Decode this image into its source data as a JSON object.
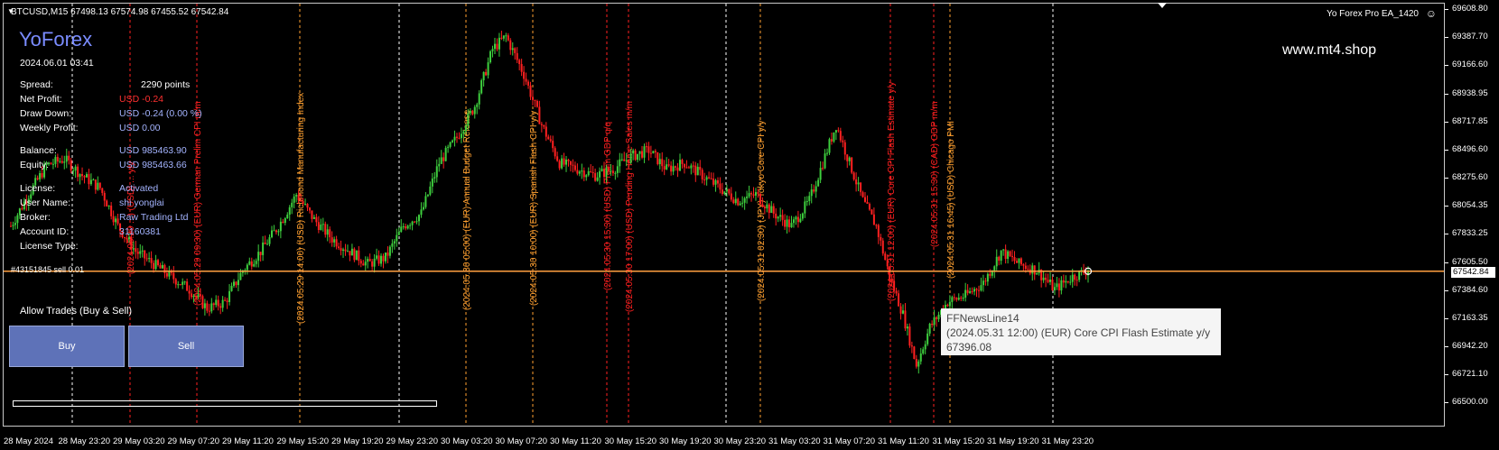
{
  "header": {
    "symbol_info": "BTCUSD,M15  67498.13 67574.98 67455.52 67542.84",
    "ea_name": "Yo Forex Pro EA_1420"
  },
  "panel": {
    "brand": "YoForex",
    "datetime": "2024.06.01 03:41",
    "website": "www.mt4.shop",
    "rows": [
      {
        "label": "Spread:",
        "value": "2290 points"
      },
      {
        "label": "Net Profit:",
        "value": "USD -0.24"
      },
      {
        "label": "Draw Down:",
        "value": "USD -0.24 (0.00 %)"
      },
      {
        "label": "Weekly Profit:",
        "value": "USD 0.00"
      },
      {
        "label": "Balance:",
        "value": "USD 985463.90"
      },
      {
        "label": "Equity:",
        "value": "USD 985463.66"
      },
      {
        "label": "License:",
        "value": "Activated"
      },
      {
        "label": "User Name:",
        "value": "shi yonglai"
      },
      {
        "label": "Broker:",
        "value": "Raw Trading Ltd"
      },
      {
        "label": "Account ID:",
        "value": "31160381"
      },
      {
        "label": "License Type:",
        "value": ""
      }
    ],
    "order_label": "#43151845 sell 0.01",
    "allow_trades": "Allow Trades (Buy & Sell)",
    "buy_label": "Buy",
    "sell_label": "Sell"
  },
  "tooltip": {
    "title": "FFNewsLine14",
    "event": "(2024.05.31 12:00) (EUR) Core CPI Flash Estimate y/y",
    "price": "67396.08"
  },
  "price_axis": {
    "ticks": [
      "69608.80",
      "69387.70",
      "69166.60",
      "68938.95",
      "68717.85",
      "68496.60",
      "68275.60",
      "68054.35",
      "67833.25",
      "67605.50",
      "67384.60",
      "67163.35",
      "66942.20",
      "66721.10",
      "66500.00"
    ],
    "current_price": "67542.84"
  },
  "time_axis": {
    "ticks": [
      "28 May 2024",
      "28 May 23:20",
      "29 May 03:20",
      "29 May 07:20",
      "29 May 11:20",
      "29 May 15:20",
      "29 May 19:20",
      "29 May 23:20",
      "30 May 03:20",
      "30 May 07:20",
      "30 May 11:20",
      "30 May 15:20",
      "30 May 19:20",
      "30 May 23:20",
      "31 May 03:20",
      "31 May 07:20",
      "31 May 11:20",
      "31 May 15:20",
      "31 May 19:20",
      "31 May 23:20"
    ]
  },
  "news_lines": [
    {
      "text": "(2024.05.29 ...) (USD) ... y/y",
      "color": "#ff2020"
    },
    {
      "text": "(2024.05.29 09:30) (EUR) German Prelim CPI m/m",
      "color": "#ff2020"
    },
    {
      "text": "(2024.05.29 14:00) (USD) Richmond Manufacturing Index",
      "color": "#ffa030"
    },
    {
      "text": "(2024.05.30 05:00) (EUR) Annual Budget Release",
      "color": "#ffa030"
    },
    {
      "text": "(2024.05.30 10:00) (EUR) Spanish Flash CPI y/y",
      "color": "#ffa030"
    },
    {
      "text": "(2024.05.30 15:30) (USD) Prelim GDP q/q",
      "color": "#ff2020"
    },
    {
      "text": "(2024.05.30 17:00) (USD) Pending Home Sales m/m",
      "color": "#ff2020"
    },
    {
      "text": "(2024.05.31 02:30) (JPY) Tokyo Core CPI y/y",
      "color": "#ffa030"
    },
    {
      "text": "(2024.05.31 12:00) (EUR) Core CPI Flash Estimate y/y",
      "color": "#ff2020"
    },
    {
      "text": "(2024.05.31 15:30) (CAD) GDP m/m",
      "color": "#ff2020"
    },
    {
      "text": "(2024.05.31 16:45) (USD) Chicago PMI",
      "color": "#ffa030"
    }
  ],
  "colors": {
    "bull": "#3ecf3e",
    "bear": "#ff2020",
    "price_line": "#ffa040",
    "panel_value": "#a4b4ff",
    "brand": "#7a8cff"
  },
  "chart_data": {
    "type": "candlestick",
    "symbol": "BTCUSD",
    "timeframe": "M15",
    "ylim": [
      66500.0,
      69608.8
    ],
    "current_price": 67542.84,
    "close_path": [
      [
        0,
        67900
      ],
      [
        8,
        68150
      ],
      [
        16,
        68380
      ],
      [
        24,
        68430
      ],
      [
        32,
        68300
      ],
      [
        40,
        68200
      ],
      [
        48,
        67900
      ],
      [
        56,
        67700
      ],
      [
        64,
        67600
      ],
      [
        72,
        67500
      ],
      [
        80,
        67400
      ],
      [
        88,
        67250
      ],
      [
        96,
        67300
      ],
      [
        104,
        67550
      ],
      [
        112,
        67700
      ],
      [
        120,
        67900
      ],
      [
        128,
        68150
      ],
      [
        136,
        67950
      ],
      [
        144,
        67800
      ],
      [
        152,
        67700
      ],
      [
        160,
        67600
      ],
      [
        168,
        67650
      ],
      [
        176,
        67900
      ],
      [
        184,
        68000
      ],
      [
        192,
        68400
      ],
      [
        200,
        68600
      ],
      [
        208,
        68850
      ],
      [
        216,
        69300
      ],
      [
        222,
        69400
      ],
      [
        230,
        69100
      ],
      [
        238,
        68700
      ],
      [
        246,
        68400
      ],
      [
        254,
        68350
      ],
      [
        262,
        68300
      ],
      [
        270,
        68350
      ],
      [
        278,
        68450
      ],
      [
        286,
        68500
      ],
      [
        294,
        68350
      ],
      [
        302,
        68400
      ],
      [
        310,
        68300
      ],
      [
        318,
        68200
      ],
      [
        326,
        68100
      ],
      [
        334,
        68150
      ],
      [
        342,
        68000
      ],
      [
        350,
        67900
      ],
      [
        358,
        68100
      ],
      [
        366,
        68500
      ],
      [
        370,
        68700
      ],
      [
        376,
        68400
      ],
      [
        382,
        68100
      ],
      [
        388,
        67900
      ],
      [
        394,
        67500
      ],
      [
        400,
        67200
      ],
      [
        406,
        66800
      ],
      [
        412,
        67100
      ],
      [
        420,
        67300
      ],
      [
        428,
        67350
      ],
      [
        436,
        67450
      ],
      [
        444,
        67700
      ],
      [
        452,
        67600
      ],
      [
        460,
        67550
      ],
      [
        468,
        67400
      ],
      [
        476,
        67500
      ],
      [
        484,
        67560
      ]
    ]
  }
}
